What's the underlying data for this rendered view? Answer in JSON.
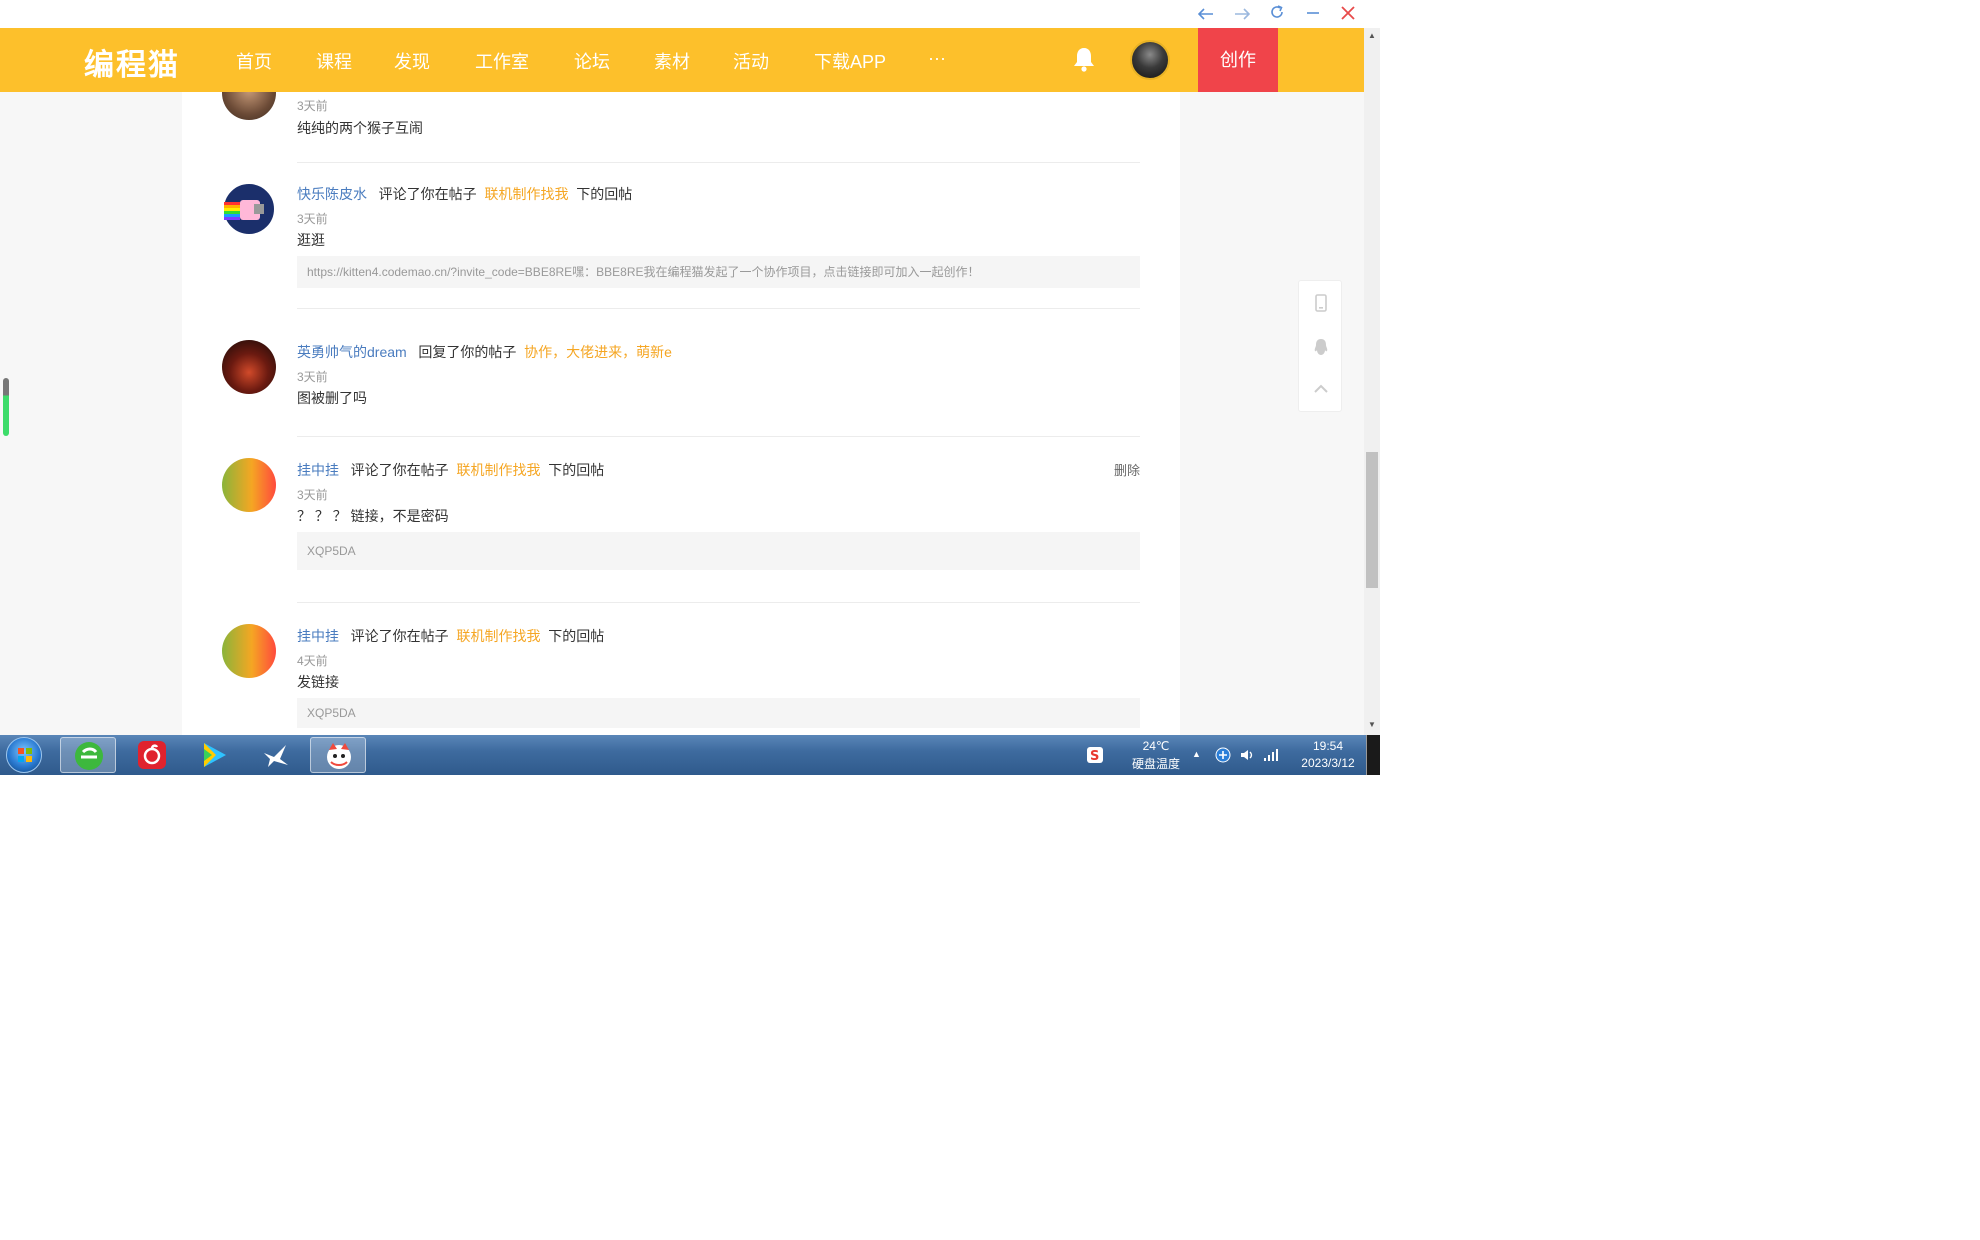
{
  "window": {
    "back_icon": "back-arrow-icon",
    "forward_icon": "forward-arrow-icon",
    "refresh_icon": "refresh-icon",
    "minimize_icon": "minimize-icon",
    "close_icon": "close-icon"
  },
  "nav": {
    "logo": "编程猫",
    "items": [
      "首页",
      "课程",
      "发现",
      "工作室",
      "论坛",
      "素材",
      "活动",
      "下载APP",
      "···"
    ],
    "create_label": "创作",
    "accent_color": "#fdc02b",
    "create_color": "#f0444a"
  },
  "notifications": [
    {
      "time": "3天前",
      "text": "纯纯的两个猴子互闹"
    },
    {
      "user": "快乐陈皮水",
      "action": "评论了你在帖子",
      "post": "联机制作找我",
      "suffix": "下的回帖",
      "time": "3天前",
      "text": "逛逛",
      "quote": "https://kitten4.codemao.cn/?invite_code=BBE8RE嘿：BBE8RE我在编程猫发起了一个协作项目，点击链接即可加入一起创作！"
    },
    {
      "user": "英勇帅气的dream",
      "action": "回复了你的帖子",
      "post": "协作，大佬进来，萌新e",
      "time": "3天前",
      "text": "图被删了吗"
    },
    {
      "user": "挂中挂",
      "action": "评论了你在帖子",
      "post": "联机制作找我",
      "suffix": "下的回帖",
      "time": "3天前",
      "text": "？ ？ ？ 链接，不是密码",
      "quote": "XQP5DA",
      "delete_label": "删除"
    },
    {
      "user": "挂中挂",
      "action": "评论了你在帖子",
      "post": "联机制作找我",
      "suffix": "下的回帖",
      "time": "4天前",
      "text": "发链接",
      "quote": "XQP5DA"
    }
  ],
  "taskbar": {
    "weather_temp": "24℃",
    "weather_label": "硬盘温度",
    "clock_time": "19:54",
    "clock_date": "2023/3/12"
  }
}
